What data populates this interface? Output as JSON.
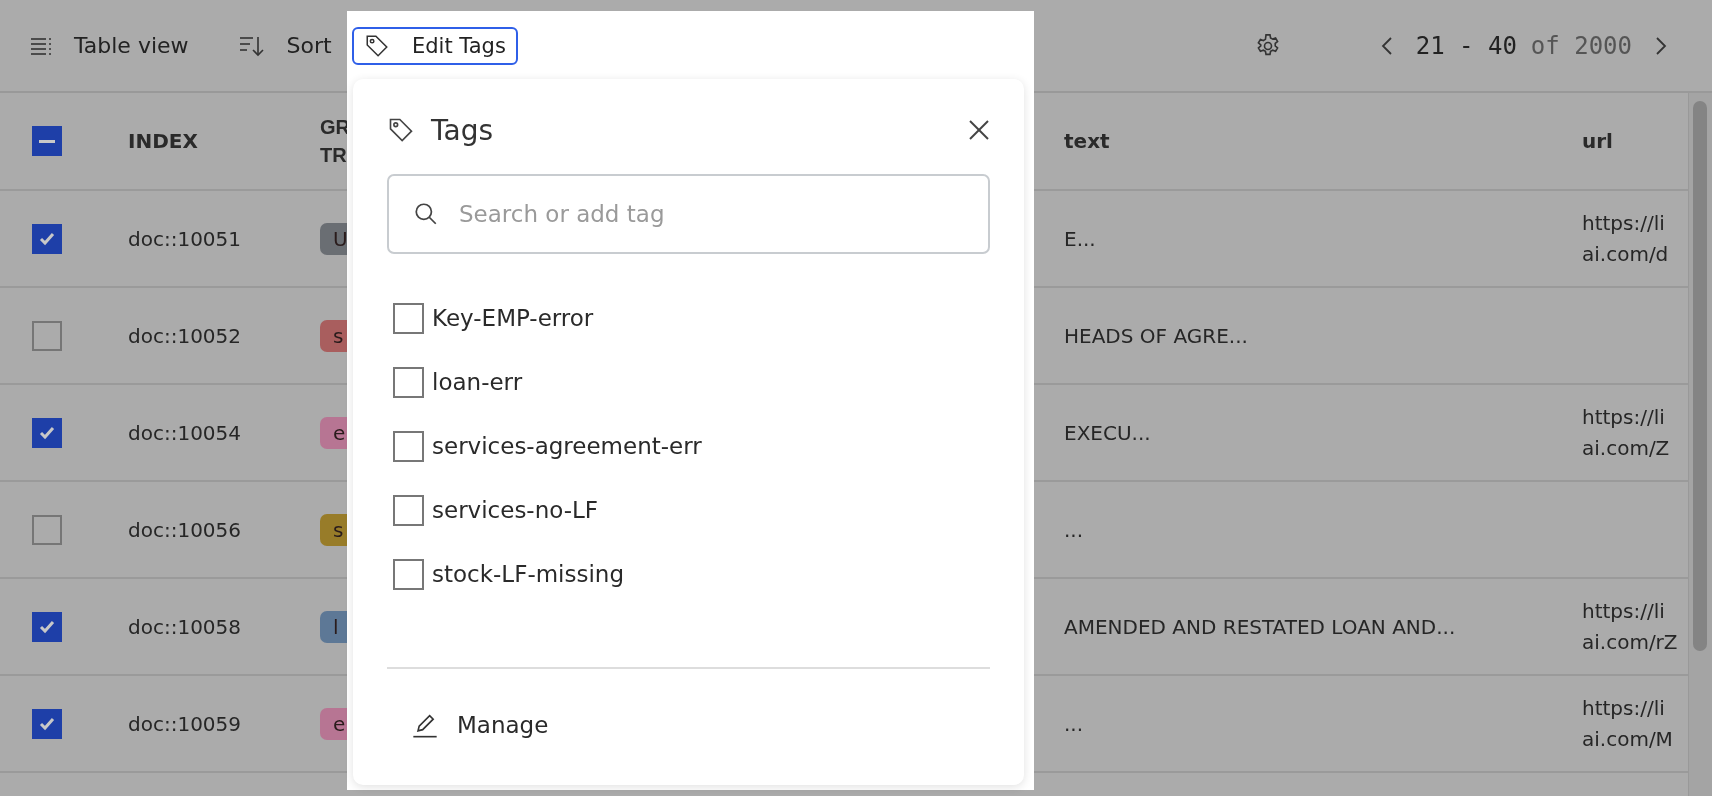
{
  "toolbar": {
    "view_button": "Table view",
    "sort_button": "Sort",
    "edit_tags_button": {
      "label": "Edit Tags",
      "selected": true
    },
    "pagination": {
      "range": "21 - 40",
      "total": "of 2000"
    }
  },
  "table": {
    "header_checkbox": {
      "indeterminate": true
    },
    "columns": [
      "INDEX",
      "GR\nTR",
      "text",
      "url"
    ],
    "rows": [
      {
        "checked": true,
        "index": "doc::10051",
        "badge": {
          "label": "U",
          "color": "#6a6e73"
        },
        "text": "E...",
        "url": "https://li\nai.com/d"
      },
      {
        "checked": false,
        "index": "doc::10052",
        "badge": {
          "label": "s",
          "color": "#a95e5e"
        },
        "text": "HEADS OF AGRE..."
      },
      {
        "checked": true,
        "index": "doc::10054",
        "badge": {
          "label": "e",
          "color": "#b77593"
        },
        "text": "EXECU...",
        "url": "https://li\nai.com/Z"
      },
      {
        "checked": false,
        "index": "doc::10056",
        "badge": {
          "label": "s",
          "color": "#987c29"
        },
        "text": "..."
      },
      {
        "checked": true,
        "index": "doc::10058",
        "badge": {
          "label": "l",
          "color": "#5d7896"
        },
        "text": "AMENDED AND RESTATED LOAN AND...",
        "url": "https://li\nai.com/rZ"
      },
      {
        "checked": true,
        "index": "doc::10059",
        "badge": {
          "label": "e",
          "color": "#b77593"
        },
        "text": "...",
        "url": "https://li\nai.com/M"
      }
    ]
  },
  "tags_popup": {
    "title": "Tags",
    "search": {
      "placeholder": "Search or add tag"
    },
    "tags": [
      {
        "label": "Key-EMP-error",
        "checked": false
      },
      {
        "label": "loan-err",
        "checked": false
      },
      {
        "label": "services-agreement-err",
        "checked": false
      },
      {
        "label": "services-no-LF",
        "checked": false
      },
      {
        "label": "stock-LF-missing",
        "checked": false
      }
    ],
    "manage_button": "Manage"
  }
}
